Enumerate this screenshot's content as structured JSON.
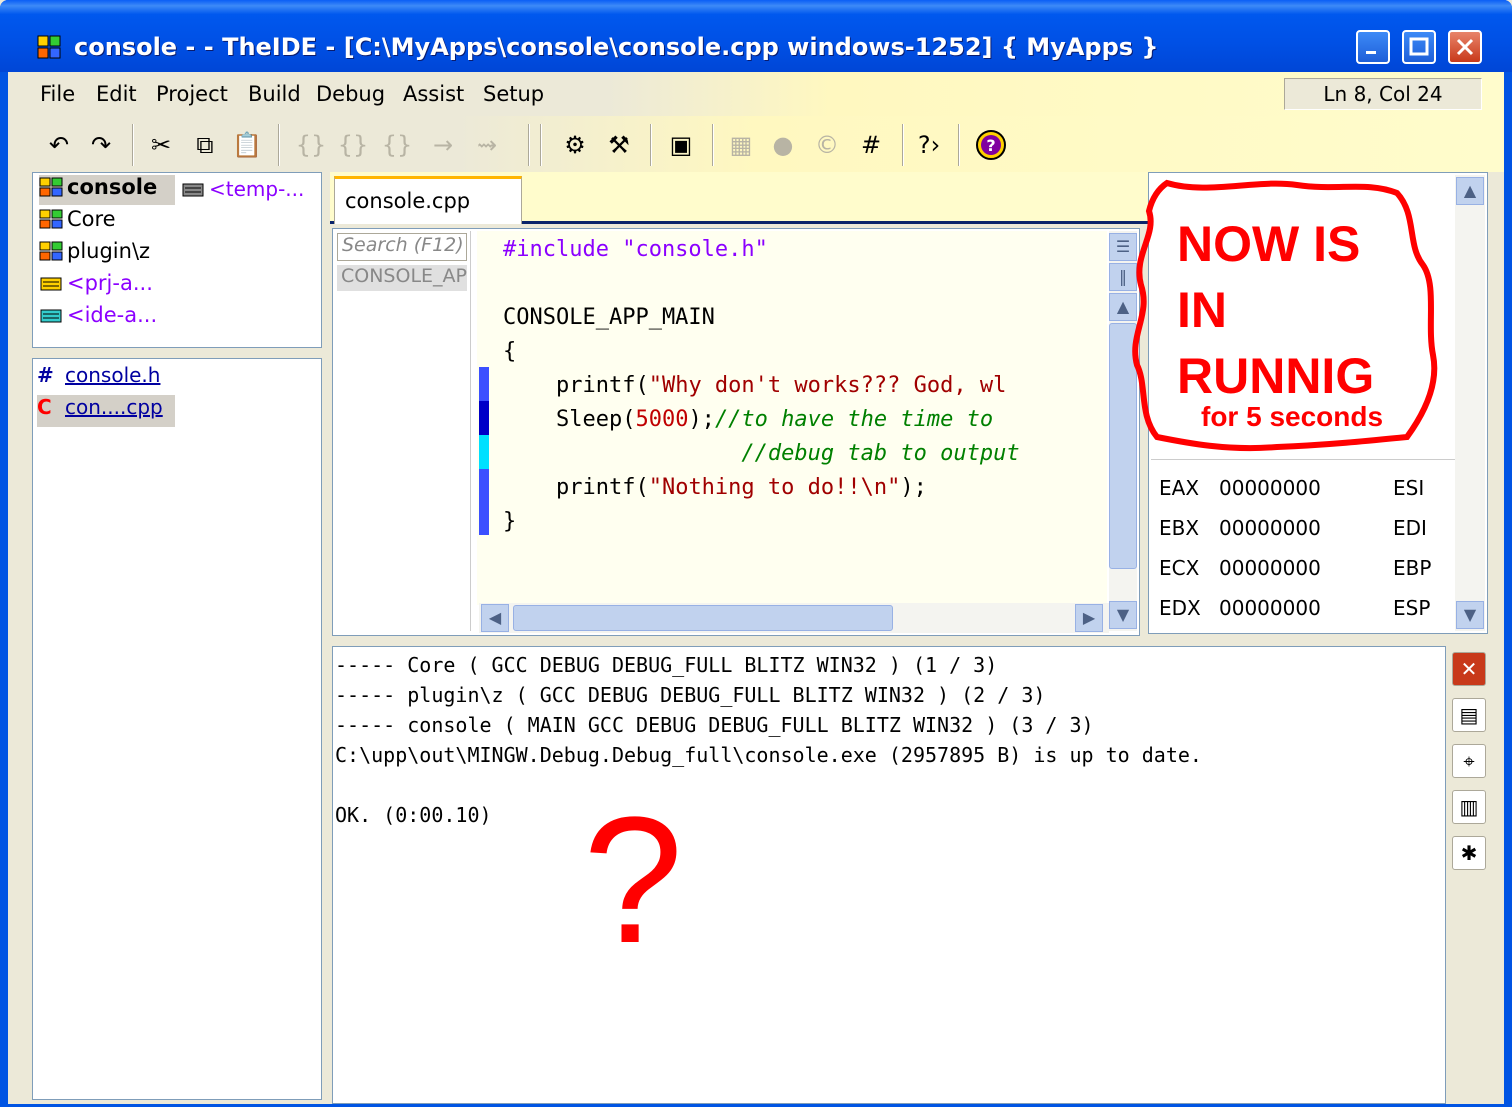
{
  "window": {
    "title": "console - - TheIDE - [C:\\MyApps\\console\\console.cpp windows-1252] { MyApps }"
  },
  "menu": [
    "File",
    "Edit",
    "Project",
    "Build",
    "Debug",
    "Assist",
    "Setup"
  ],
  "status": {
    "position": "Ln 8, Col 24"
  },
  "packages": {
    "items": [
      {
        "label": "console",
        "selected": true
      },
      {
        "label": "Core"
      },
      {
        "label": "plugin\\z"
      },
      {
        "label": "<prj-a..."
      },
      {
        "label": "<ide-a..."
      }
    ],
    "column2": "<temp-..."
  },
  "files": [
    {
      "icon": "#",
      "label": "console.h"
    },
    {
      "icon": "C",
      "label": "con....cpp",
      "selected": true
    }
  ],
  "editor": {
    "tab": "console.cpp",
    "nav_search": "Search (F12)",
    "nav_item": "CONSOLE_APP",
    "lines": {
      "l1": "#include \"console.h\"",
      "l3": "CONSOLE_APP_MAIN",
      "l4": "{",
      "l5a": "    printf(",
      "l5b": "\"Why don't works??? God, wl",
      "l6a": "    Sleep(",
      "l6b": "5000",
      "l6c": ");",
      "l6d": "//to have the time to",
      "l7": "                  //debug tab to output",
      "l8a": "    printf(",
      "l8b": "\"Nothing to do!!\\n\"",
      "l8c": ");",
      "l9": "}"
    }
  },
  "debug": {
    "annotation_l1": "NOW IS",
    "annotation_l2": "IN",
    "annotation_l3": "RUNNIG",
    "annotation_l4": "for 5 seconds",
    "registers": [
      {
        "name": "EAX",
        "value": "00000000",
        "right": "ESI"
      },
      {
        "name": "EBX",
        "value": "00000000",
        "right": "EDI"
      },
      {
        "name": "ECX",
        "value": "00000000",
        "right": "EBP"
      },
      {
        "name": "EDX",
        "value": "00000000",
        "right": "ESP"
      }
    ]
  },
  "output": {
    "lines": [
      "----- Core ( GCC DEBUG DEBUG_FULL BLITZ WIN32 ) (1 / 3)",
      "----- plugin\\z ( GCC DEBUG DEBUG_FULL BLITZ WIN32 ) (2 / 3)",
      "----- console ( MAIN GCC DEBUG DEBUG_FULL BLITZ WIN32 ) (3 / 3)",
      "C:\\upp\\out\\MINGW.Debug.Debug_full\\console.exe (2957895 B) is up to date.",
      "",
      "OK. (0:00.10)"
    ],
    "annotation": "?"
  },
  "colors": {
    "title_bar": "#0054e3",
    "annotation": "#ff0000",
    "panel_bg": "#ece9d8"
  }
}
